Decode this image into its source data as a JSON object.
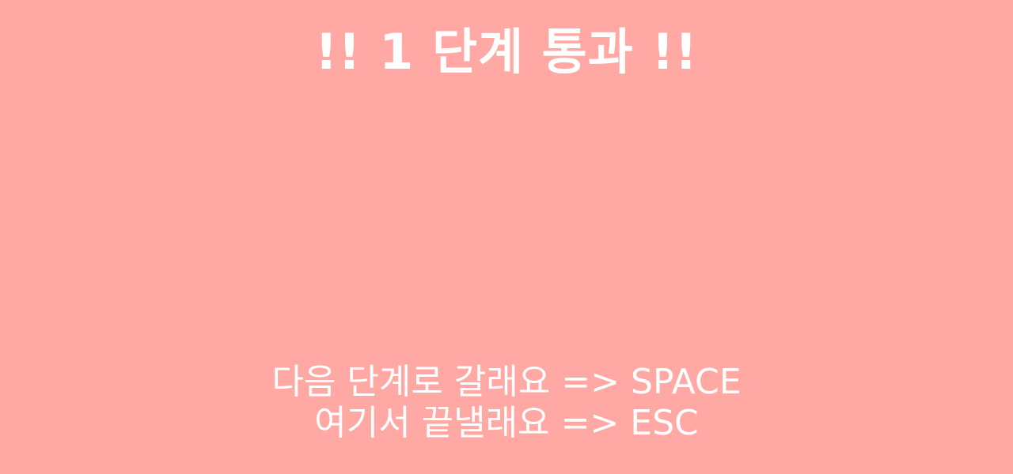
{
  "title": "!! 1 단계 통과 !!",
  "instructions": {
    "next_stage": "다음 단계로 갈래요 => SPACE",
    "quit": "여기서 끝낼래요 => ESC"
  },
  "colors": {
    "background": "#ffa8a4",
    "text": "#ffffff"
  }
}
